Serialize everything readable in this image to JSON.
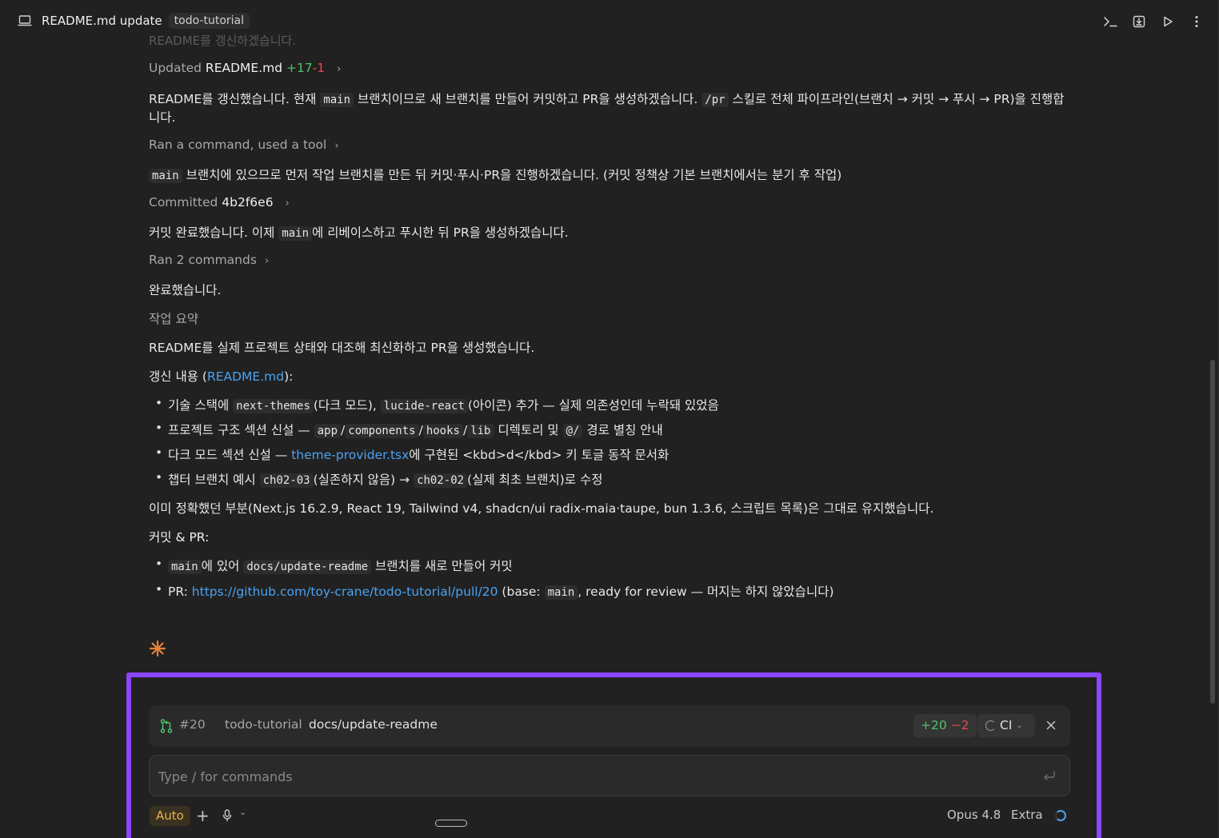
{
  "header": {
    "title": "README.md update",
    "badge": "todo-tutorial",
    "icons": [
      "terminal-icon",
      "download-icon",
      "play-icon",
      "more-vertical-icon"
    ]
  },
  "messages": {
    "faded_top": "README를 갱신하겠습니다.",
    "updated": {
      "prefix": "Updated",
      "file": "README.md",
      "added": "+17",
      "removed": "-1"
    },
    "msg1_a": "README를 갱신했습니다. 현재 ",
    "msg1_code": "main",
    "msg1_b": " 브랜치이므로 새 브랜치를 만들어 커밋하고 PR을 생성하겠습니다. ",
    "msg1_code2": "/pr",
    "msg1_c": " 스킬로 전체 파이프라인(브랜치 → 커밋 → 푸시 → PR)을 진행합",
    "msg1_d": "니다.",
    "ran_tool": "Ran a command, used a tool",
    "msg2_code": "main",
    "msg2_text": " 브랜치에 있으므로 먼저 작업 브랜치를 만든 뒤 커밋·푸시·PR을 진행하겠습니다. (커밋 정책상 기본 브랜치에서는 분기 후 작업)",
    "committed": {
      "prefix": "Committed",
      "hash": "4b2f6e6"
    },
    "msg3_a": "커밋 완료했습니다. 이제 ",
    "msg3_code": "main",
    "msg3_b": "에 리베이스하고 푸시한 뒤 PR을 생성하겠습니다.",
    "ran2": "Ran 2 commands",
    "done": "완료했습니다.",
    "summary_heading": "작업 요약",
    "summary_line": "README를 실제 프로젝트 상태와 대조해 최신화하고 PR을 생성했습니다.",
    "changes_a": "갱신 내용 (",
    "changes_link": "README.md",
    "changes_b": "):",
    "bullets1": [
      {
        "a": "기술 스택에 ",
        "c1": "next-themes",
        "b": "(다크 모드), ",
        "c2": "lucide-react",
        "d": "(아이콘) 추가 — 실제 의존성인데 누락돼 있었음"
      },
      {
        "a": "프로젝트 구조 섹션 신설 — ",
        "c1": "app",
        "s1": "/",
        "c2": "components",
        "s2": "/",
        "c3": "hooks",
        "s3": "/",
        "c4": "lib",
        "b": " 디렉토리 및 ",
        "c5": "@/",
        "d": " 경로 별칭 안내"
      },
      {
        "a": "다크 모드 섹션 신설 — ",
        "link": "theme-provider.tsx",
        "b": "에 구현된 <kbd>d</kbd> 키 토글 동작 문서화"
      },
      {
        "a": "챕터 브랜치 예시 ",
        "c1": "ch02-03",
        "b": "(실존하지 않음) → ",
        "c2": "ch02-02",
        "d": "(실제 최초 브랜치)로 수정"
      }
    ],
    "kept_line": "이미 정확했던 부분(Next.js 16.2.9, React 19, Tailwind v4, shadcn/ui radix-maia·taupe, bun 1.3.6, 스크립트 목록)은 그대로 유지했습니다.",
    "commit_pr_heading": "커밋 & PR:",
    "bullets2": [
      {
        "c1": "main",
        "a": "에 있어 ",
        "c2": "docs/update-readme",
        "b": " 브랜치를 새로 만들어 커밋"
      },
      {
        "a": "PR: ",
        "link": "https://github.com/toy-crane/todo-tutorial/pull/20",
        "b": " (base: ",
        "c1": "main",
        "d": ", ready for review — 머지는 하지 않았습니다)"
      }
    ]
  },
  "pr_bar": {
    "number": "#20",
    "repo": "todo-tutorial",
    "branch": "docs/update-readme",
    "added": "+20",
    "removed": "−2",
    "ci": "CI"
  },
  "composer": {
    "placeholder": "Type / for commands",
    "mode": "Auto",
    "model": "Opus 4.8",
    "effort": "Extra"
  },
  "colors": {
    "accent": "#8b46ff",
    "link": "#4aa3f2",
    "added": "#4cc26a",
    "removed": "#e5484d",
    "auto": "#e8b24a"
  }
}
